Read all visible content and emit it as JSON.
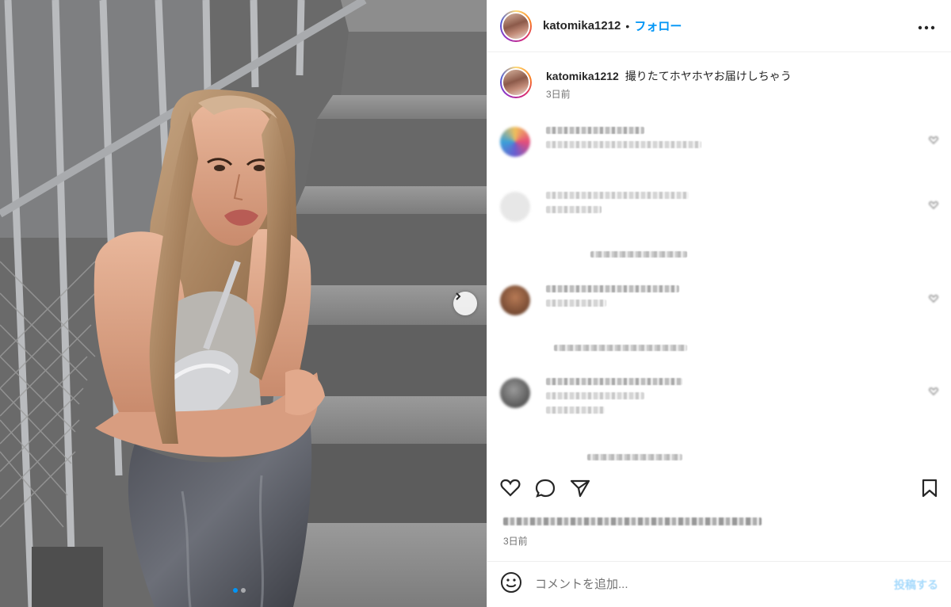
{
  "post": {
    "username": "katomika1212",
    "separator": "•",
    "follow_label": "フォロー",
    "more_label": "•••",
    "caption_username": "katomika1212",
    "caption_text": "撮りたてホヤホヤお届けしちゃう",
    "caption_time": "3日前",
    "post_time": "3日前"
  },
  "comment_box": {
    "placeholder": "コメントを追加...",
    "post_label": "投稿する"
  },
  "icons": {
    "carousel_next": "chevron-right-icon",
    "like": "heart-icon",
    "comment": "comment-icon",
    "share": "paper-plane-icon",
    "save": "bookmark-icon",
    "emoji": "emoji-icon"
  },
  "colors": {
    "accent": "#0095f6",
    "muted": "#737373",
    "text": "#262626"
  }
}
